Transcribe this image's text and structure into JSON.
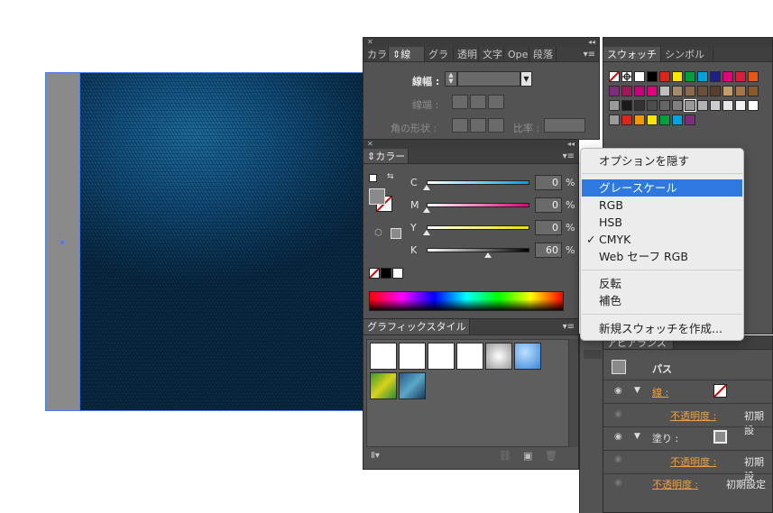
{
  "stroke_panel": {
    "tabs": [
      "カラ",
      "線",
      "グラ",
      "透明",
      "文字",
      "Oper",
      "段落"
    ],
    "width_label": "線幅 :",
    "cap_label": "線端 :",
    "corner_label": "角の形状 :",
    "ratio_label": "比率 :"
  },
  "color_panel": {
    "title": "カラー",
    "channels": [
      {
        "label": "C",
        "value": "0",
        "unit": "%",
        "fraction": 0.0
      },
      {
        "label": "M",
        "value": "0",
        "unit": "%",
        "fraction": 0.0
      },
      {
        "label": "Y",
        "value": "0",
        "unit": "%",
        "fraction": 0.0
      },
      {
        "label": "K",
        "value": "60",
        "unit": "%",
        "fraction": 0.6
      }
    ]
  },
  "graphic_styles_panel": {
    "title": "グラフィックスタイル"
  },
  "swatches_panel": {
    "tabs": [
      "スウォッチ",
      "シンボル"
    ]
  },
  "appearance_panel": {
    "title": "アピアランス",
    "path_label": "パス",
    "stroke_label": "線 :",
    "opacity_label": "不透明度 :",
    "default_value": "初期設",
    "fill_label": "塗り :",
    "opacity_default_full": "初期設定"
  },
  "dropdown": {
    "items": [
      {
        "label": "オプションを隠す",
        "highlighted": false,
        "checked": false
      },
      {
        "label": "グレースケール",
        "highlighted": true,
        "checked": false
      },
      {
        "label": "RGB",
        "highlighted": false,
        "checked": false
      },
      {
        "label": "HSB",
        "highlighted": false,
        "checked": false
      },
      {
        "label": "CMYK",
        "highlighted": false,
        "checked": true
      },
      {
        "label": "Web セーフ RGB",
        "highlighted": false,
        "checked": false
      },
      {
        "label": "反転",
        "highlighted": false,
        "checked": false
      },
      {
        "label": "補色",
        "highlighted": false,
        "checked": false
      },
      {
        "label": "新規スウォッチを作成...",
        "highlighted": false,
        "checked": false
      }
    ],
    "checkmark": "✓"
  },
  "colors": {
    "panel_bg": "#535353",
    "highlight": "#2e79e0",
    "denim_blue": "#135283",
    "selection": "#4a7ee8",
    "link_orange": "#e8a04a"
  },
  "icons": [
    "close-icon",
    "collapse-icon",
    "panel-menu-icon",
    "eye-icon",
    "disclosure-triangle-icon"
  ]
}
